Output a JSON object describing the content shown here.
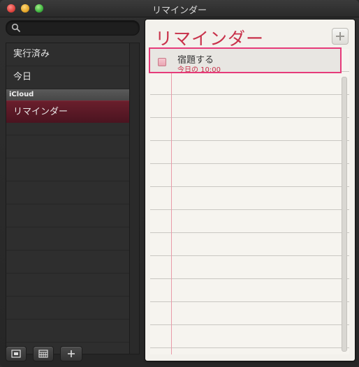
{
  "window": {
    "title": "リマインダー"
  },
  "search": {
    "placeholder": ""
  },
  "sidebar": {
    "items": [
      {
        "label": "実行済み"
      },
      {
        "label": "今日"
      }
    ],
    "section_header": "iCloud",
    "selected_item": {
      "label": "リマインダー"
    }
  },
  "main": {
    "title": "リマインダー",
    "tasks": [
      {
        "title": "宿題する",
        "due": "今日の 10:00",
        "completed": false
      }
    ]
  },
  "colors": {
    "accent": "#c8314a",
    "highlight_outline": "#e63b7a",
    "selected_sidebar": "#5c1a27"
  },
  "icons": {
    "search": "magnifier-icon",
    "add": "plus-icon",
    "footer": [
      "show-sidebar-icon",
      "calendar-icon",
      "plus-icon"
    ]
  }
}
